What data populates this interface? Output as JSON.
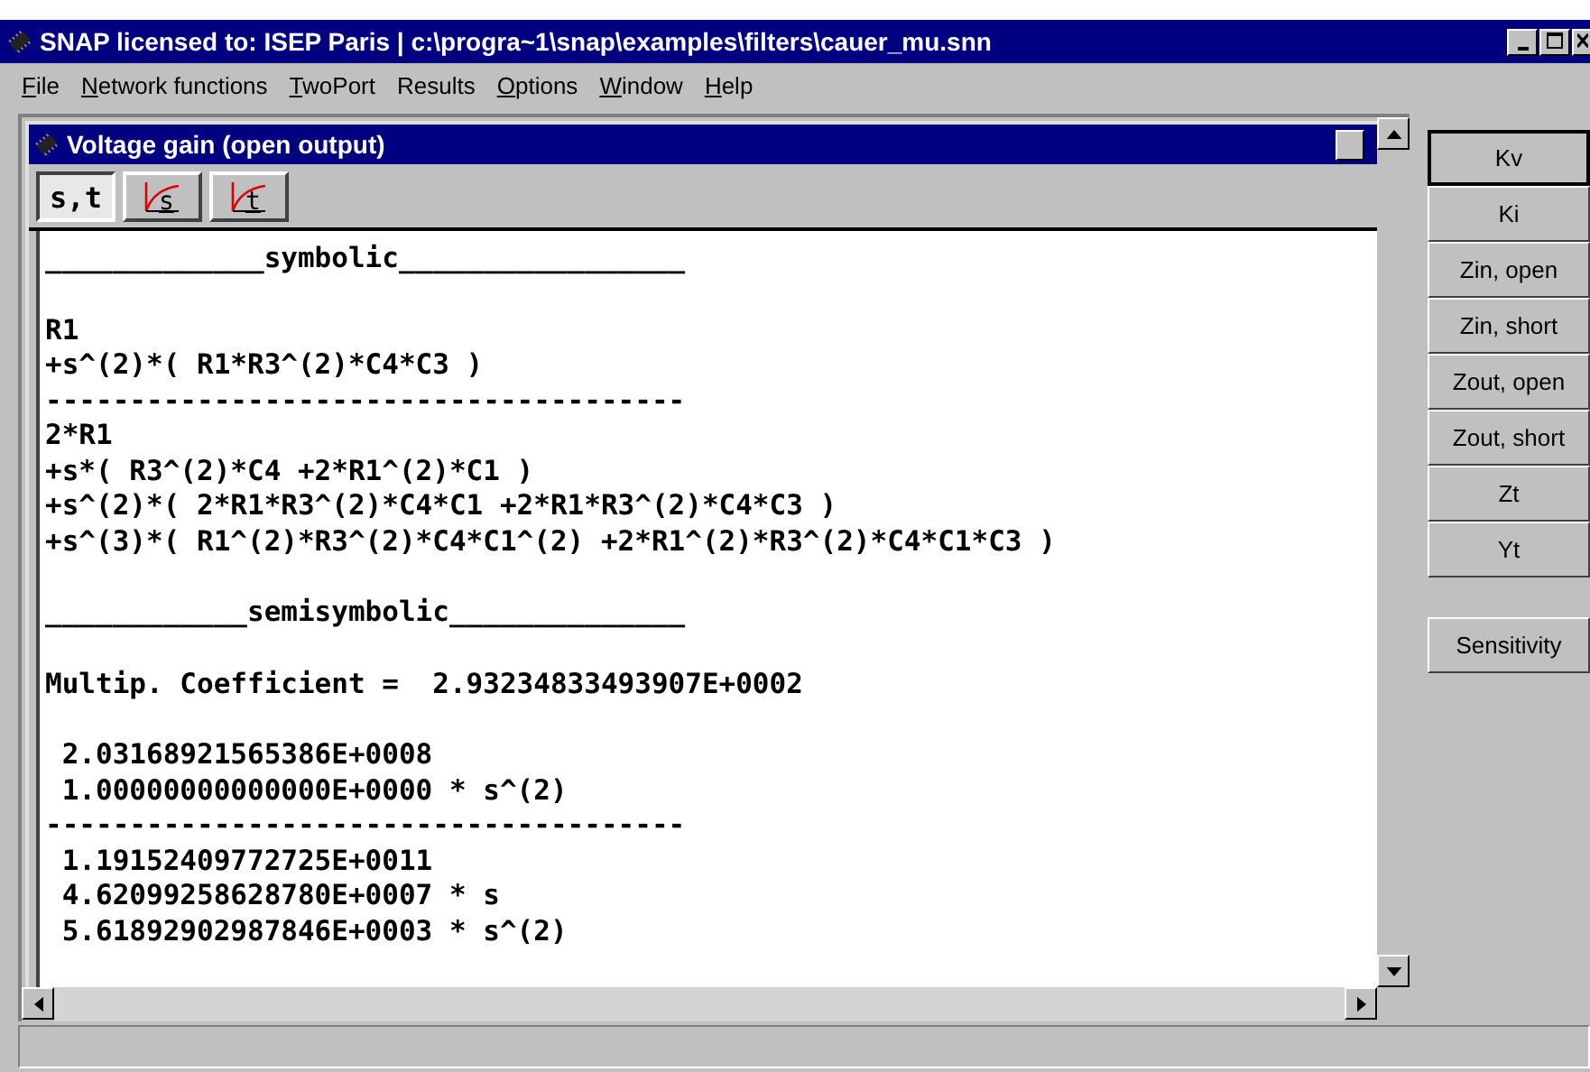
{
  "window": {
    "title": "SNAP licensed to: ISEP Paris | c:\\progra~1\\snap\\examples\\filters\\cauer_mu.snn"
  },
  "menu": [
    {
      "label": "File",
      "underlined": true
    },
    {
      "label": "Network functions",
      "underlined": true
    },
    {
      "label": "TwoPort",
      "underlined": true
    },
    {
      "label": "Results",
      "underlined": false
    },
    {
      "label": "Options",
      "underlined": true
    },
    {
      "label": "Window",
      "underlined": true
    },
    {
      "label": "Help",
      "underlined": true
    }
  ],
  "child_window": {
    "title": "Voltage gain (open output)",
    "tabs": [
      {
        "label": "s,t",
        "kind": "text",
        "selected": true
      },
      {
        "label": "s",
        "kind": "curve",
        "selected": false
      },
      {
        "label": "t",
        "kind": "curve",
        "selected": false
      }
    ],
    "blocks": [
      [
        "_____________symbolic_________________"
      ],
      [
        "R1",
        "+s^(2)*( R1*R3^(2)*C4*C3 )",
        "--------------------------------------",
        "2*R1",
        "+s*( R3^(2)*C4 +2*R1^(2)*C1 )",
        "+s^(2)*( 2*R1*R3^(2)*C4*C1 +2*R1*R3^(2)*C4*C3 )",
        "+s^(3)*( R1^(2)*R3^(2)*C4*C1^(2) +2*R1^(2)*R3^(2)*C4*C1*C3 )"
      ],
      [
        "____________semisymbolic______________"
      ],
      [
        "Multip. Coefficient =  2.93234833493907E+0002"
      ],
      [
        " 2.03168921565386E+0008",
        " 1.00000000000000E+0000 * s^(2)",
        "--------------------------------------",
        " 1.19152409772725E+0011",
        " 4.62099258628780E+0007 * s",
        " 5.61892902987846E+0003 * s^(2)"
      ]
    ]
  },
  "functions": [
    {
      "label": "Kv",
      "selected": true
    },
    {
      "label": "Ki",
      "selected": false
    },
    {
      "label": "Zin, open",
      "selected": false
    },
    {
      "label": "Zin, short",
      "selected": false
    },
    {
      "label": "Zout, open",
      "selected": false
    },
    {
      "label": "Zout, short",
      "selected": false
    },
    {
      "label": "Zt",
      "selected": false
    },
    {
      "label": "Yt",
      "selected": false
    }
  ],
  "sensitivity_button": {
    "label": "Sensitivity"
  }
}
